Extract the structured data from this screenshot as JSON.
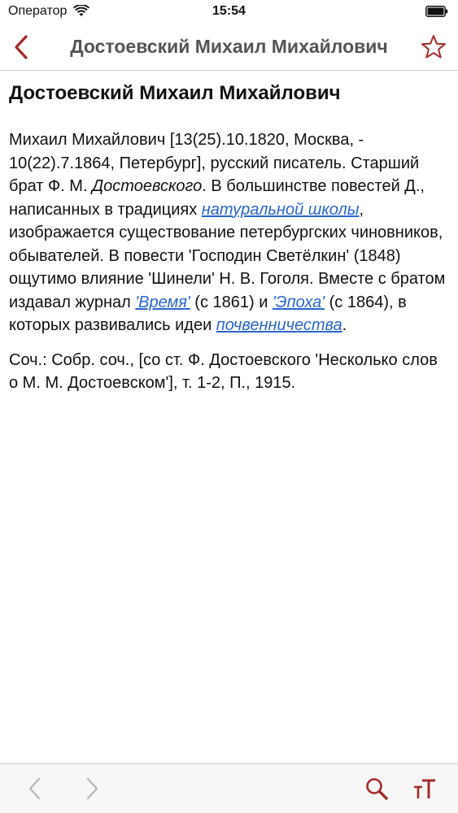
{
  "status_bar": {
    "carrier": "Оператор",
    "time": "15:54",
    "icons": [
      "wifi-icon",
      "battery-icon"
    ]
  },
  "nav": {
    "title": "Достоевский Михаил Михайлович",
    "back_icon": "chevron-left-icon",
    "favorite_icon": "star-outline-icon"
  },
  "article": {
    "heading": "Достоевский Михаил Михайлович",
    "p1": {
      "t1": "Михаил Михайлович [13(25).10.1820, Москва, - 10(22).7.1864, Петербург], русский писатель. Старший брат Ф. М. ",
      "em1": "Достоевского",
      "t2": ". В большинстве повестей Д., написанных в традициях ",
      "link1": "натуральной школы",
      "t3": ", изображается существование петербургских чиновников, обывателей. В повести 'Господин Светёлкин' (1848) ощутимо влияние 'Шинели' Н. В. Гоголя. Вместе с братом издавал журнал ",
      "link2": "'Время'",
      "t4": " (с 1861) и ",
      "link3": "'Эпоха'",
      "t5": " (с 1864), в которых развивались идеи ",
      "link4": "почвенничества",
      "t6": "."
    },
    "p2": "Соч.: Собр. соч., [со ст. Ф. Достоевского 'Несколько слов о М. М. Достоевском'], т. 1-2, П., 1915."
  },
  "toolbar": {
    "icons": [
      "prev-arrow-icon",
      "next-arrow-icon",
      "search-icon",
      "font-size-icon"
    ],
    "font_size_label": "тT"
  },
  "colors": {
    "accent": "#a32a2a",
    "link": "#2a66cc",
    "disabled": "#b8b8b8"
  }
}
